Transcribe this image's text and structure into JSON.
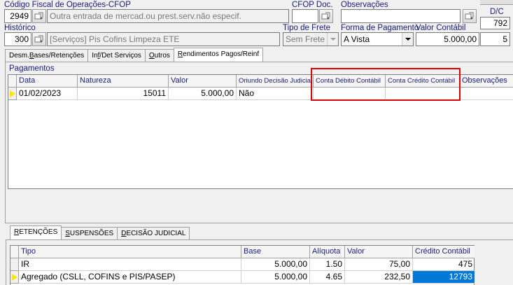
{
  "header": {
    "cfop_label": "Código Fiscal de Operações-CFOP",
    "cfop_code": "2949",
    "cfop_desc": "Outra entrada de mercad.ou prest.serv.não especif.",
    "cfop_doc_label": "CFOP Doc.",
    "cfop_doc_value": "",
    "obs_label": "Observações",
    "obs_value": "",
    "dc_label": "D/C",
    "dc_value": "792",
    "historico_label": "Histórico",
    "historico_code": "300",
    "historico_desc": "[Serviços] Pis Cofins Limpeza ETE",
    "frete_label": "Tipo de Frete",
    "frete_value": "Sem Frete",
    "pagamento_label": "Forma de Pagamento",
    "pagamento_value": "A Vista",
    "valor_label": "Valor Contábil",
    "valor_value": "5.000,00",
    "small_value": "5"
  },
  "tabs": [
    {
      "pre": "Desm.",
      "u": "B",
      "post": "ases/Retenções"
    },
    {
      "pre": "In",
      "u": "f",
      "post": "/Det Serviços"
    },
    {
      "pre": "",
      "u": "O",
      "post": "utros"
    },
    {
      "pre": "",
      "u": "R",
      "post": "endimentos Pagos/Reinf"
    }
  ],
  "pagamentos": {
    "title": "Pagamentos",
    "columns": [
      "Data",
      "Natureza",
      "Valor",
      "Oriundo Decisão Judicial",
      "Conta Débito Contábil",
      "Conta Crédito Contábil",
      "Observações"
    ],
    "rows": [
      {
        "data": "01/02/2023",
        "natureza": "15011",
        "valor": "5.000,00",
        "oriundo": "Não",
        "debito": "",
        "credito": "",
        "obs": ""
      }
    ]
  },
  "highlight_color": "#e00000",
  "bottom_tabs": [
    {
      "u": "R",
      "post": "ETENÇÕES"
    },
    {
      "u": "S",
      "post": "USPENSÕES"
    },
    {
      "u": "D",
      "post": "ECISÃO JUDICIAL"
    }
  ],
  "retencoes": {
    "columns": [
      "Tipo",
      "Base",
      "Alíquota",
      "Valor",
      "Crédito Contábil"
    ],
    "rows": [
      {
        "tipo": "IR",
        "base": "5.000,00",
        "aliquota": "1.50",
        "valor": "75,00",
        "credito": "475"
      },
      {
        "tipo": "Agregado (CSLL, COFINS e PIS/PASEP)",
        "base": "5.000,00",
        "aliquota": "4.65",
        "valor": "232,50",
        "credito": "12793"
      }
    ],
    "selected_color": "#0078d7"
  }
}
